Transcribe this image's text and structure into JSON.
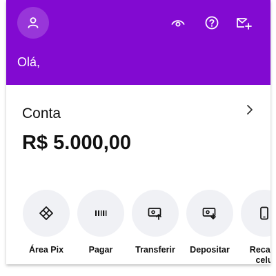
{
  "header": {
    "greeting": "Olá,",
    "icons": [
      "person-icon",
      "eye-icon",
      "help-icon",
      "mail-plus-icon"
    ]
  },
  "account": {
    "label": "Conta",
    "balance": "R$ 5.000,00"
  },
  "actions": [
    {
      "label": "Área Pix",
      "icon": "pix-icon"
    },
    {
      "label": "Pagar",
      "icon": "barcode-icon"
    },
    {
      "label": "Transferir",
      "icon": "transfer-icon"
    },
    {
      "label": "Depositar",
      "icon": "deposit-icon"
    },
    {
      "label": "Recarga de celular",
      "label_line1": "Recarg",
      "label_line2": "celu",
      "icon": "phone-icon"
    }
  ],
  "colors": {
    "brand": "#820ad1",
    "action_bg": "#f0f1f5",
    "text": "#111111"
  }
}
